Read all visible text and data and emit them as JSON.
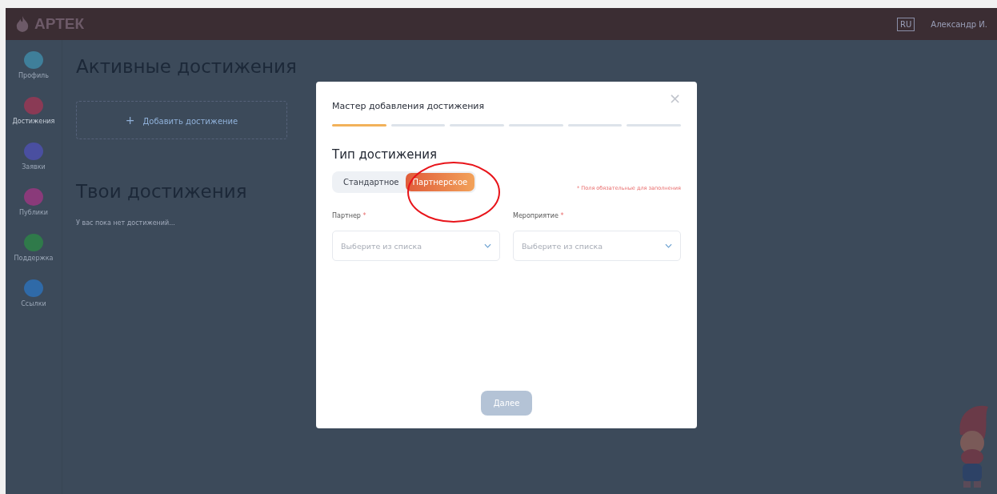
{
  "header": {
    "logo": "АРТЕК",
    "language": "RU",
    "user": "Александр И."
  },
  "sidebar": {
    "items": [
      {
        "label": "Профиль",
        "selected": false,
        "color": "#3f7f9a"
      },
      {
        "label": "Достижения",
        "selected": true,
        "color": "#8a3a55"
      },
      {
        "label": "Заявки",
        "selected": false,
        "color": "#4a4fa0"
      },
      {
        "label": "Публики",
        "selected": false,
        "color": "#8a3a7a"
      },
      {
        "label": "Поддержка",
        "selected": false,
        "color": "#2f7a4a"
      },
      {
        "label": "Ссылки",
        "selected": false,
        "color": "#2f6aa8"
      }
    ]
  },
  "main": {
    "active_title": "Активные достижения",
    "add_button": {
      "icon": "+",
      "label": "Добавить достижение"
    },
    "yours_title": "Твои достижения",
    "empty_text": "У вас пока нет достижений..."
  },
  "dialog": {
    "title": "Мастер добавления достижения",
    "close": "×",
    "steps": [
      {
        "active": true
      },
      {
        "active": false
      },
      {
        "active": false
      },
      {
        "active": false
      },
      {
        "active": false
      },
      {
        "active": false
      }
    ],
    "section_title": "Тип достижения",
    "types": [
      {
        "label": "Стандартное",
        "selected": false
      },
      {
        "label": "Партнерское",
        "selected": true
      }
    ],
    "required_note": "* Поля обязательные для заполнения",
    "fields": [
      {
        "label": "Партнер",
        "required_mark": "*",
        "placeholder": "Выберите из списка"
      },
      {
        "label": "Мероприятие",
        "required_mark": "*",
        "placeholder": "Выберите из списка"
      }
    ],
    "next_button": {
      "label": "Далее",
      "disabled": true
    }
  }
}
